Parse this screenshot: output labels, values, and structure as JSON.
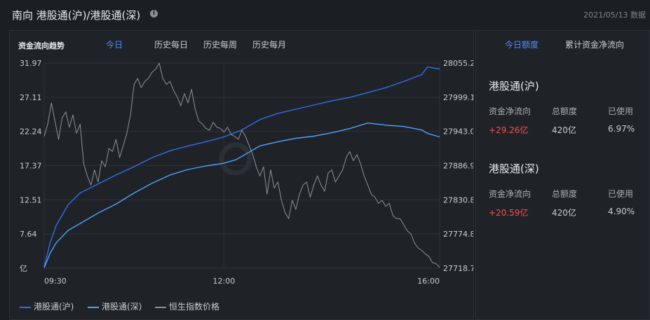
{
  "header": {
    "title": "南向 港股通(沪)/港股通(深)",
    "date": "2021/05/13 数据"
  },
  "chart_panel": {
    "title": "资金流向趋势",
    "tabs": [
      {
        "label": "今日",
        "active": true
      },
      {
        "label": "历史每日",
        "active": false
      },
      {
        "label": "历史每周",
        "active": false
      },
      {
        "label": "历史每月",
        "active": false
      }
    ]
  },
  "colors": {
    "sh": "#2f6fe8",
    "sz": "#4ba3ff",
    "index": "#8e9298",
    "up": "#ff4d4f",
    "accent": "#4a90ff"
  },
  "chart_data": {
    "type": "line",
    "x_ticks": [
      "09:30",
      "12:00",
      "16:00"
    ],
    "x_range": [
      0,
      330
    ],
    "x_tick_values": [
      0,
      150,
      330
    ],
    "y_left": {
      "unit": "亿",
      "range": [
        2.34,
        31.97
      ],
      "ticks": [
        "31.97",
        "27.11",
        "22.24",
        "17.37",
        "12.51",
        "7.64",
        "亿"
      ]
    },
    "y_right": {
      "range": [
        27718.7,
        28055.2
      ],
      "ticks": [
        "28055.2",
        "27999.1",
        "27943.0",
        "27886.9",
        "27830.8",
        "27774.8",
        "27718.7"
      ]
    },
    "grid": true,
    "legend_position": "bottom",
    "series": [
      {
        "name": "港股通(沪)",
        "axis": "left",
        "x": [
          0,
          5,
          10,
          20,
          30,
          45,
          60,
          75,
          90,
          105,
          120,
          135,
          150,
          165,
          180,
          195,
          210,
          225,
          240,
          255,
          270,
          285,
          300,
          315,
          320,
          330
        ],
        "values": [
          2.5,
          6.0,
          8.5,
          11.5,
          13.2,
          14.5,
          15.8,
          17.0,
          18.3,
          19.3,
          20.0,
          20.6,
          21.3,
          22.3,
          23.8,
          24.7,
          25.3,
          25.9,
          26.5,
          27.0,
          27.7,
          28.4,
          29.3,
          30.3,
          31.4,
          31.1
        ]
      },
      {
        "name": "港股通(深)",
        "axis": "left",
        "x": [
          0,
          5,
          10,
          20,
          30,
          45,
          60,
          75,
          90,
          105,
          120,
          135,
          150,
          160,
          170,
          180,
          195,
          210,
          225,
          240,
          255,
          270,
          285,
          300,
          315,
          320,
          330
        ],
        "values": [
          2.4,
          4.5,
          6.0,
          7.8,
          8.8,
          10.3,
          11.6,
          13.2,
          14.6,
          15.8,
          16.6,
          17.1,
          17.5,
          18.0,
          19.0,
          20.0,
          20.6,
          21.1,
          21.4,
          21.9,
          22.5,
          23.3,
          23.0,
          22.8,
          22.3,
          21.8,
          21.3
        ]
      },
      {
        "name": "恒生指数价格",
        "axis": "right",
        "x": [
          0,
          3,
          6,
          9,
          12,
          15,
          18,
          21,
          24,
          27,
          30,
          33,
          36,
          39,
          42,
          45,
          48,
          51,
          54,
          57,
          60,
          63,
          66,
          69,
          72,
          75,
          78,
          81,
          84,
          87,
          90,
          93,
          96,
          99,
          102,
          105,
          108,
          111,
          114,
          117,
          120,
          123,
          126,
          129,
          132,
          135,
          138,
          141,
          144,
          147,
          150,
          153,
          156,
          159,
          162,
          165,
          168,
          171,
          174,
          177,
          180,
          183,
          186,
          189,
          192,
          195,
          198,
          201,
          204,
          207,
          210,
          213,
          216,
          219,
          222,
          225,
          228,
          231,
          234,
          237,
          240,
          243,
          246,
          249,
          252,
          255,
          258,
          261,
          264,
          267,
          270,
          273,
          276,
          279,
          282,
          285,
          288,
          291,
          294,
          297,
          300,
          303,
          306,
          309,
          312,
          315,
          318,
          321,
          324,
          327,
          330
        ],
        "values": [
          27935,
          27955,
          27990,
          27960,
          27930,
          27965,
          27975,
          27950,
          27970,
          27940,
          27955,
          27890,
          27870,
          27855,
          27880,
          27860,
          27895,
          27885,
          27915,
          27910,
          27930,
          27900,
          27920,
          27940,
          27970,
          28020,
          28030,
          28015,
          28025,
          28030,
          28040,
          28045,
          28055,
          28030,
          28020,
          28025,
          28010,
          28000,
          27985,
          28005,
          27990,
          28012,
          27980,
          27960,
          27955,
          27948,
          27945,
          27958,
          27950,
          27948,
          27942,
          27950,
          27938,
          27935,
          27930,
          27945,
          27935,
          27920,
          27905,
          27885,
          27870,
          27885,
          27840,
          27880,
          27850,
          27860,
          27830,
          27810,
          27800,
          27830,
          27815,
          27840,
          27855,
          27860,
          27835,
          27855,
          27870,
          27855,
          27845,
          27875,
          27880,
          27860,
          27870,
          27880,
          27900,
          27910,
          27895,
          27905,
          27890,
          27870,
          27855,
          27840,
          27835,
          27825,
          27830,
          27820,
          27825,
          27805,
          27800,
          27800,
          27790,
          27780,
          27775,
          27760,
          27752,
          27748,
          27742,
          27738,
          27728,
          27726,
          27720
        ]
      }
    ]
  },
  "side_panel": {
    "tabs": [
      {
        "label": "今日额度",
        "active": true
      },
      {
        "label": "累计资金净流向",
        "active": false
      }
    ],
    "col_heads": [
      "资金净流向",
      "总额度",
      "已使用"
    ],
    "sections": [
      {
        "title": "港股通(沪)",
        "net_flow": "+29.26亿",
        "quota": "420亿",
        "used": "6.97%"
      },
      {
        "title": "港股通(深)",
        "net_flow": "+20.59亿",
        "quota": "420亿",
        "used": "4.90%"
      }
    ]
  }
}
